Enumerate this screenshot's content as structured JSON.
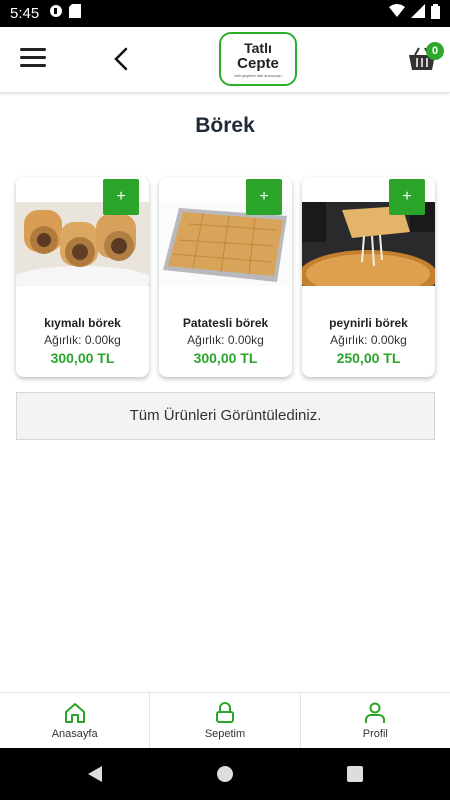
{
  "status_bar": {
    "time": "5:45"
  },
  "header": {
    "logo_line1": "Tatlı",
    "logo_line2": "Cepte",
    "logo_tagline": "tatlı şeylerin tatlı sunucuşu",
    "cart_count": "0"
  },
  "page": {
    "title": "Börek"
  },
  "products": [
    {
      "name": "kıymalı börek",
      "weight": "Ağırlık: 0.00kg",
      "price": "300,00 TL",
      "add_label": "+"
    },
    {
      "name": "Patatesli börek",
      "weight": "Ağırlık: 0.00kg",
      "price": "300,00 TL",
      "add_label": "+"
    },
    {
      "name": "peynirli börek",
      "weight": "Ağırlık: 0.00kg",
      "price": "250,00 TL",
      "add_label": "+"
    }
  ],
  "end_message": "Tüm Ürünleri Görüntülediniz.",
  "bottom_nav": [
    {
      "label": "Anasayfa",
      "icon": "home-icon"
    },
    {
      "label": "Sepetim",
      "icon": "lock-icon"
    },
    {
      "label": "Profil",
      "icon": "user-icon"
    }
  ],
  "colors": {
    "accent": "#2aa52a",
    "title": "#1f2a36"
  }
}
